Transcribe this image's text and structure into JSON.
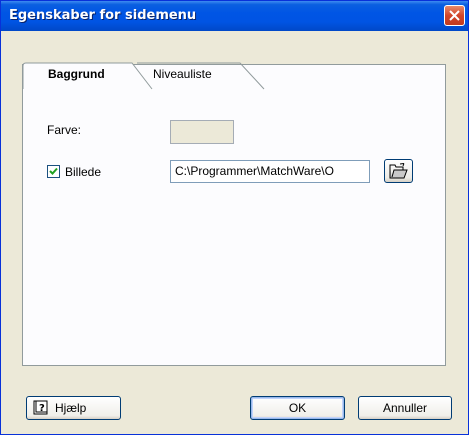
{
  "window": {
    "title": "Egenskaber for sidemenu"
  },
  "tabs": [
    {
      "label": "Baggrund",
      "active": true
    },
    {
      "label": "Niveauliste",
      "active": false
    }
  ],
  "form": {
    "color_label": "Farve:",
    "image_checkbox_label": "Billede",
    "image_checked": true,
    "image_path": "C:\\Programmer\\MatchWare\\O"
  },
  "buttons": {
    "help": "Hjælp",
    "ok": "OK",
    "cancel": "Annuller"
  },
  "icons": {
    "close": "close-icon",
    "folder": "open-folder-icon",
    "help": "help-book-icon",
    "check": "checkmark-icon"
  },
  "colors": {
    "titlebar": "#0054e3",
    "dialog_bg": "#ece9d8",
    "close_button": "#d2452a"
  }
}
